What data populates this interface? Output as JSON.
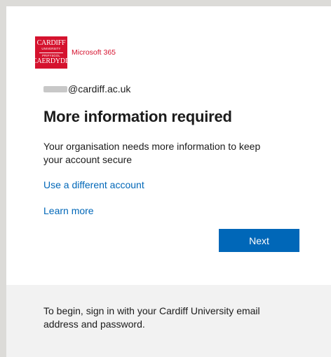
{
  "brand": {
    "logo_lines": [
      "CARDIFF",
      "UNIVERSITY",
      "PRIFYSGOL",
      "CAERDYDD"
    ],
    "product_label": "Microsoft 365",
    "color": "#d5122e"
  },
  "account": {
    "email_domain": "@cardiff.ac.uk"
  },
  "main": {
    "title": "More information required",
    "description": "Your organisation needs more information to keep your account secure",
    "use_different_account": "Use a different account",
    "learn_more": "Learn more",
    "next_label": "Next"
  },
  "footer": {
    "text": "To begin, sign in with your Cardiff University email address and password."
  },
  "colors": {
    "accent": "#0067b8",
    "footer_bg": "#f2f2f2"
  }
}
